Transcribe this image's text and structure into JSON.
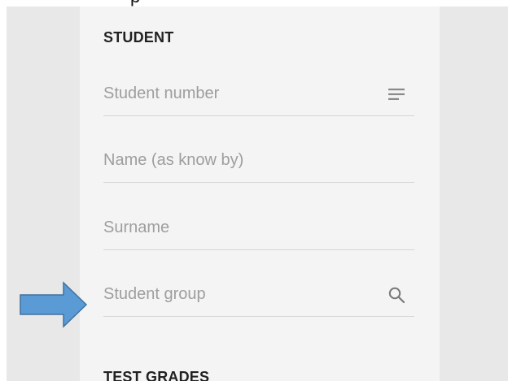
{
  "header": {
    "partial_text": "p"
  },
  "student_section": {
    "title": "STUDENT",
    "fields": [
      {
        "placeholder": "Student number",
        "icon": "list-icon"
      },
      {
        "placeholder": "Name (as know by)"
      },
      {
        "placeholder": "Surname"
      },
      {
        "placeholder": "Student group",
        "icon": "search-icon"
      }
    ]
  },
  "grades_section": {
    "title": "TEST GRADES"
  },
  "colors": {
    "arrow_fill": "#5b9bd5",
    "arrow_stroke": "#41719c",
    "panel_bg": "#f4f4f4",
    "gutter_bg": "#e8e8e8"
  }
}
